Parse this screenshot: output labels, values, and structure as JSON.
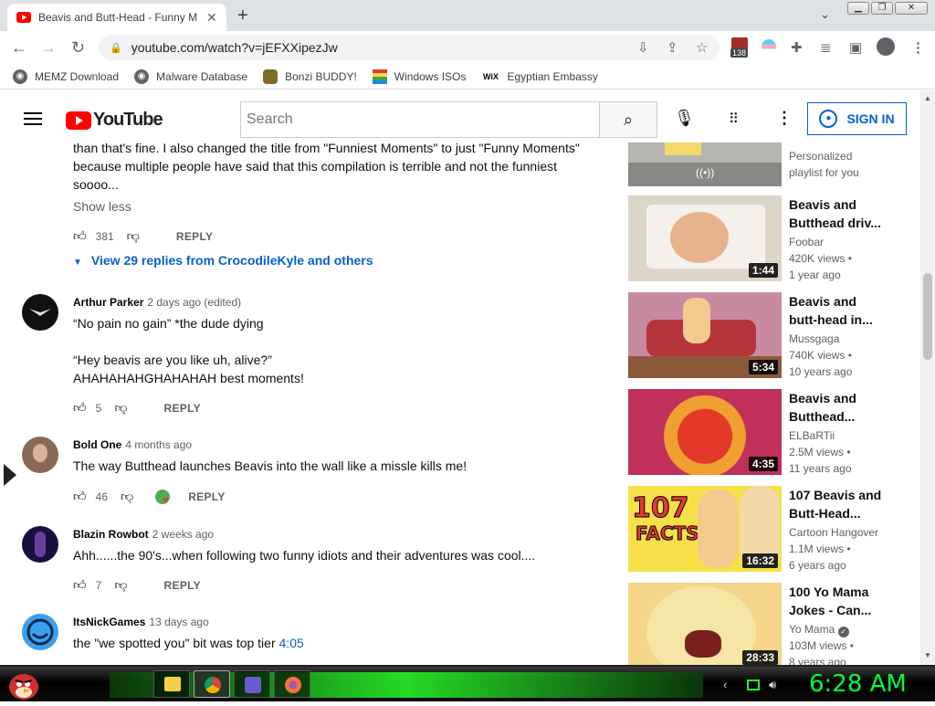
{
  "browser": {
    "tab_title": "Beavis and Butt-Head - Funny M",
    "url": "youtube.com/watch?v=jEFXXipezJw",
    "extension_badge": "138",
    "bookmarks": [
      {
        "label": "MEMZ Download",
        "icon": "globe-icon"
      },
      {
        "label": "Malware Database",
        "icon": "globe-icon"
      },
      {
        "label": "Bonzi BUDDY!",
        "icon": "bonzi-icon"
      },
      {
        "label": "Windows ISOs",
        "icon": "windows-icon"
      },
      {
        "label": "Egyptian Embassy",
        "icon": "wix-icon"
      }
    ],
    "wix_text": "WiX"
  },
  "youtube": {
    "logo": "YouTube",
    "search_placeholder": "Search",
    "signin_label": "SIGN IN"
  },
  "comments": {
    "top_partial": {
      "text_lines": [
        "than that's fine. I also changed the title from \"Funniest Moments\" to just \"Funny Moments\"",
        "because multiple people have said that this compilation is terrible and not the funniest",
        "soooo..."
      ],
      "show_less": "Show less",
      "likes": "381",
      "reply": "REPLY",
      "view_replies": "View 29 replies from CrocodileKyle and others"
    },
    "items": [
      {
        "author": "Arthur Parker",
        "date": "2 days ago (edited)",
        "lines": [
          "“No pain no gain” *the dude dying",
          "",
          "“Hey beavis are you like uh, alive?”",
          "AHAHAHAHGHAHAHAH best moments!"
        ],
        "likes": "5",
        "reply": "REPLY"
      },
      {
        "author": "Bold One",
        "date": "4 months ago",
        "lines": [
          "The way Butthead launches Beavis into the wall like a missle kills me!"
        ],
        "likes": "46",
        "reply": "REPLY"
      },
      {
        "author": "Blazin Rowbot",
        "date": "2 weeks ago",
        "lines": [
          "Ahh......the 90's...when following two funny idiots and their adventures was cool...."
        ],
        "likes": "7",
        "reply": "REPLY"
      },
      {
        "author": "ItsNickGames",
        "date": "13 days ago",
        "text_before": "the \"we spotted you\" bit was top tier ",
        "timestamp": "4:05"
      }
    ]
  },
  "sidebar": {
    "partial": {
      "meta": [
        "Personalized",
        "playlist for you"
      ]
    },
    "videos": [
      {
        "title_lines": [
          "Beavis and",
          "Butthead driv..."
        ],
        "channel": "Foobar",
        "views": "420K views •",
        "age": "1 year ago",
        "duration": "1:44"
      },
      {
        "title_lines": [
          "Beavis and",
          "butt-head in..."
        ],
        "channel": "Mussgaga",
        "views": "740K views •",
        "age": "10 years ago",
        "duration": "5:34"
      },
      {
        "title_lines": [
          "Beavis and",
          "Butthead..."
        ],
        "channel": "ELBaRTii",
        "views": "2.5M views •",
        "age": "11 years ago",
        "duration": "4:35"
      },
      {
        "title_lines": [
          "107 Beavis and",
          "Butt-Head..."
        ],
        "channel": "Cartoon Hangover",
        "views": "1.1M views •",
        "age": "6 years ago",
        "duration": "16:32",
        "thumb_text_1": "107",
        "thumb_text_2": "FACTS"
      },
      {
        "title_lines": [
          "100 Yo Mama",
          "Jokes - Can..."
        ],
        "channel": "Yo Mama",
        "views": "103M views •",
        "age": "8 years ago",
        "duration": "28:33"
      }
    ]
  },
  "taskbar": {
    "clock": "6:28 AM"
  },
  "colors": {
    "youtube_red": "#ff0000",
    "link_blue": "#065fd4",
    "clock_green": "#00ff33"
  }
}
